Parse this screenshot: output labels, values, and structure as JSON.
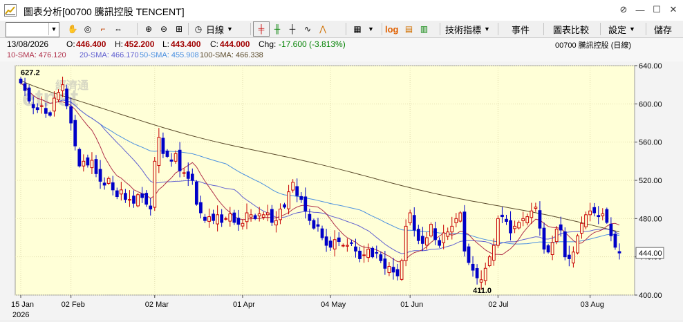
{
  "window": {
    "title": "圖表分析[00700 騰訊控股 TENCENT]",
    "icons": [
      "attach-icon",
      "minimize-icon",
      "maximize-icon",
      "close-icon"
    ]
  },
  "toolbar": {
    "code_input_value": "",
    "period_label": "日線",
    "log_label": "log",
    "indicators_label": "技術指標",
    "events_label": "事件",
    "compare_label": "圖表比較",
    "settings_label": "設定",
    "save_label": "儲存"
  },
  "info": {
    "date": "13/08/2026",
    "open_label": "O:",
    "open": "446.400",
    "high_label": "H:",
    "high": "452.200",
    "low_label": "L:",
    "low": "443.400",
    "close_label": "C:",
    "close": "444.000",
    "chg_label": "Chg:",
    "chg": "-17.600 (-3.813%)",
    "stock": "00700  騰訊控股 (日線)"
  },
  "sma": {
    "sma10": "10-SMA: 476.120",
    "sma20": "20-SMA: 466.170",
    "sma50": "50-SMA: 455.908",
    "sma100": "100-SMA: 466.338"
  },
  "colors": {
    "plot_bg": "#ffffd7",
    "up": "#c80000",
    "down": "#0000c8",
    "sma10": "#b0304a",
    "sma20": "#6060d0",
    "sma50": "#4a90e0",
    "sma100": "#5a4a2a",
    "logo_title": "#f5c400"
  },
  "chart_data": {
    "type": "candlestick",
    "y_ticks": [
      "640.00",
      "600.00",
      "560.00",
      "520.00",
      "480.00",
      "440.00",
      "400.00"
    ],
    "ylim": [
      400,
      640
    ],
    "last_price_label": "444.00",
    "x_ticks": [
      {
        "label": "15 Jan",
        "idx": 0
      },
      {
        "label": "02 Feb",
        "idx": 12
      },
      {
        "label": "02 Mar",
        "idx": 32
      },
      {
        "label": "01 Apr",
        "idx": 53
      },
      {
        "label": "04 May",
        "idx": 74
      },
      {
        "label": "01 Jun",
        "idx": 93
      },
      {
        "label": "02 Jul",
        "idx": 114
      },
      {
        "label": "03 Aug",
        "idx": 136
      }
    ],
    "year_label": "2026",
    "annotations": [
      {
        "text": "627.2",
        "idx": 1,
        "value": 627.2,
        "pos": "above"
      },
      {
        "text": "411.0",
        "idx": 109,
        "value": 411.0,
        "pos": "below"
      }
    ],
    "watermark": "經濟通 etnet",
    "closes": [
      622,
      614,
      603,
      596,
      594,
      598,
      590,
      588,
      606,
      612,
      620,
      598,
      580,
      556,
      535,
      540,
      536,
      541,
      527,
      519,
      515,
      522,
      510,
      503,
      510,
      500,
      500,
      496,
      505,
      502,
      495,
      490,
      540,
      565,
      548,
      545,
      540,
      548,
      530,
      528,
      522,
      520,
      495,
      486,
      478,
      482,
      478,
      484,
      476,
      480,
      485,
      476,
      474,
      475,
      486,
      484,
      480,
      485,
      484,
      486,
      476,
      478,
      490,
      492,
      508,
      518,
      504,
      500,
      488,
      478,
      470,
      472,
      460,
      452,
      450,
      458,
      456,
      452,
      452,
      454,
      446,
      438,
      442,
      448,
      440,
      444,
      436,
      428,
      430,
      424,
      420,
      436,
      472,
      486,
      468,
      457,
      454,
      460,
      474,
      458,
      452,
      465,
      466,
      472,
      480,
      486,
      446,
      434,
      426,
      418,
      416,
      428,
      440,
      452,
      480,
      482,
      477,
      465,
      472,
      476,
      480,
      482,
      488,
      492,
      470,
      448,
      445,
      455,
      469,
      468,
      440,
      438,
      445,
      462,
      475,
      484,
      488,
      486,
      482,
      485,
      476,
      462,
      450,
      444
    ],
    "volume": [],
    "sma10_last": 476.12,
    "sma20_last": 466.17,
    "sma50_last": 455.908,
    "sma100_last": 466.338
  }
}
